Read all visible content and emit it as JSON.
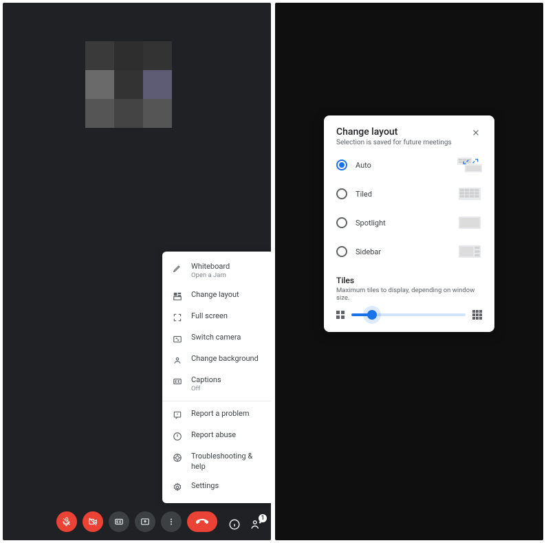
{
  "left_panel": {
    "menu": {
      "whiteboard": {
        "label": "Whiteboard",
        "sub": "Open a Jam"
      },
      "change_layout": {
        "label": "Change layout"
      },
      "full_screen": {
        "label": "Full screen"
      },
      "switch_camera": {
        "label": "Switch camera"
      },
      "change_background": {
        "label": "Change background"
      },
      "captions": {
        "label": "Captions",
        "sub": "Off"
      },
      "report_problem": {
        "label": "Report a problem"
      },
      "report_abuse": {
        "label": "Report abuse"
      },
      "troubleshooting": {
        "label": "Troubleshooting & help"
      },
      "settings": {
        "label": "Settings"
      }
    },
    "participants_count": "1"
  },
  "right_panel": {
    "dialog": {
      "title": "Change layout",
      "subtitle": "Selection is saved for future meetings",
      "options": {
        "auto": "Auto",
        "tiled": "Tiled",
        "spotlight": "Spotlight",
        "sidebar": "Sidebar"
      },
      "selected": "auto",
      "tiles": {
        "title": "Tiles",
        "subtitle": "Maximum tiles to display, depending on window size.",
        "slider_percent": 18
      }
    }
  }
}
